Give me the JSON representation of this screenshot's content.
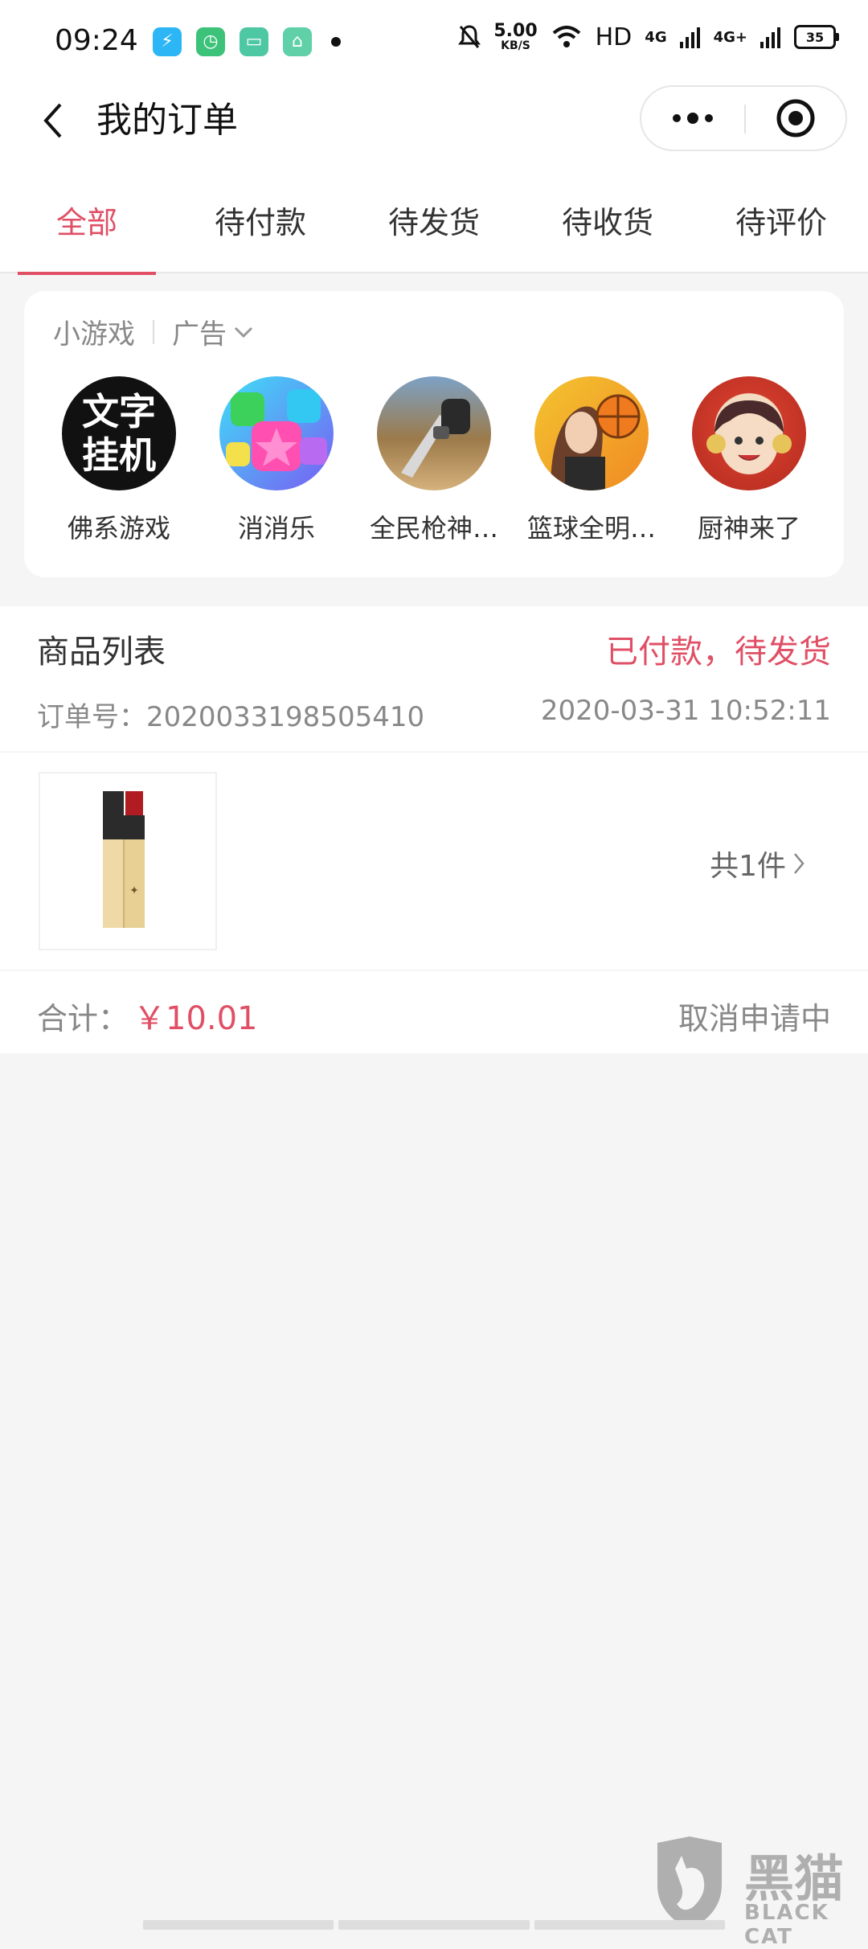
{
  "status_bar": {
    "time": "09:24",
    "speed_value": "5.00",
    "speed_unit": "KB/S",
    "hd": "HD",
    "net1": "4G",
    "net2": "4G+",
    "battery": "35"
  },
  "nav": {
    "title": "我的订单"
  },
  "tabs": [
    {
      "label": "全部",
      "active": true
    },
    {
      "label": "待付款"
    },
    {
      "label": "待发货"
    },
    {
      "label": "待收货"
    },
    {
      "label": "待评价"
    }
  ],
  "games_card": {
    "header": "小游戏",
    "ad_label": "广告",
    "games": [
      {
        "name": "佛系游戏",
        "icon_text_1": "文字",
        "icon_text_2": "挂机"
      },
      {
        "name": "消消乐"
      },
      {
        "name": "全民枪神…"
      },
      {
        "name": "篮球全明…"
      },
      {
        "name": "厨神来了"
      }
    ]
  },
  "order": {
    "goods_label": "商品列表",
    "status": "已付款，待发货",
    "order_no": "订单号：2020033198505410",
    "time": "2020-03-31 10:52:11",
    "item_count": "共1件",
    "total_label": "合计：",
    "total_amount": "￥10.01",
    "cancel_status": "取消申请中"
  },
  "watermark": {
    "text": "黑猫",
    "sub": "BLACK CAT"
  },
  "colors": {
    "accent": "#e04f65",
    "background": "#f5f5f5"
  }
}
